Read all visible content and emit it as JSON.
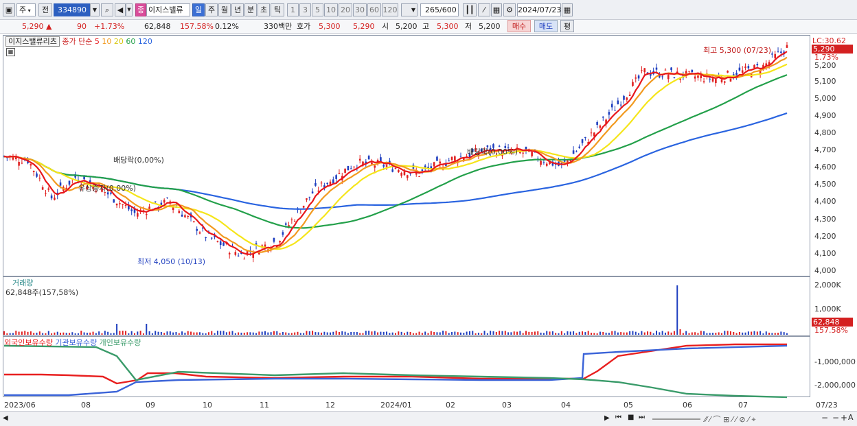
{
  "toolbar": {
    "type": "주",
    "prev": "전",
    "code": "334890",
    "sheet_icon": "종",
    "name": "이지스밸류",
    "periods": [
      "일",
      "주",
      "월",
      "년",
      "분",
      "초",
      "틱"
    ],
    "minutes": [
      "1",
      "3",
      "5",
      "10",
      "20",
      "30",
      "60",
      "120"
    ],
    "count": "265",
    "count_max": "/600",
    "date": "2024/07/23"
  },
  "quote": {
    "price": "5,290",
    "change_arrow": "▲",
    "change": "90",
    "change_pct": "+1.73%",
    "volume": "62,848",
    "volume_pct": "157.58%",
    "turnover": "0.12%",
    "amount": "330백만",
    "hoga_label": "호가",
    "hoga": "5,300",
    "hoga2": "5,290",
    "open_label": "시",
    "open": "5,200",
    "high_label": "고",
    "high": "5,300",
    "low_label": "저",
    "low": "5,200",
    "buy": "매수",
    "sell": "매도",
    "eval": "평"
  },
  "price_pane": {
    "name": "이지스밸류리츠",
    "ma_title": "종가 단순",
    "ma": [
      {
        "label": "5",
        "color": "#e8171b"
      },
      {
        "label": "10",
        "color": "#f29a1f"
      },
      {
        "label": "20",
        "color": "#f5e51a"
      },
      {
        "label": "60",
        "color": "#23a04a"
      },
      {
        "label": "120",
        "color": "#2a64e0"
      }
    ],
    "lc_label": "LC:30.62",
    "last_price": "5,290",
    "last_pct": "1.73%",
    "high_note": "최고 5,300 (07/23)",
    "low_note": "최저 4,050 (10/13)",
    "div_note": "배당락(0,00%)",
    "rights_note": "유상증자(0,00%)",
    "div_note2": "배당락(0,00%)",
    "y_ticks": [
      "5,200",
      "5,100",
      "5,000",
      "4,900",
      "4,800",
      "4,700",
      "4,600",
      "4,500",
      "4,400",
      "4,300",
      "4,200",
      "4,100",
      "4,000"
    ]
  },
  "volume_pane": {
    "title": "거래량",
    "current": "62,848주(157,58%)",
    "y_ticks": [
      "2,000K",
      "1,000K"
    ],
    "last_value": "62,848",
    "last_pct": "157.58%"
  },
  "holding_pane": {
    "series": [
      {
        "name": "외국인보유수량",
        "color": "#e81f1f"
      },
      {
        "name": "기관보유수량",
        "color": "#3a63d8"
      },
      {
        "name": "개인보유수량",
        "color": "#3a9b6a"
      }
    ],
    "y_ticks": [
      "-1,000,000",
      "-2,000,000"
    ]
  },
  "x_axis": {
    "labels": [
      "2023/06",
      "08",
      "09",
      "10",
      "11",
      "12",
      "2024/01",
      "02",
      "03",
      "04",
      "05",
      "06",
      "07"
    ],
    "end_label": "07/23"
  }
}
